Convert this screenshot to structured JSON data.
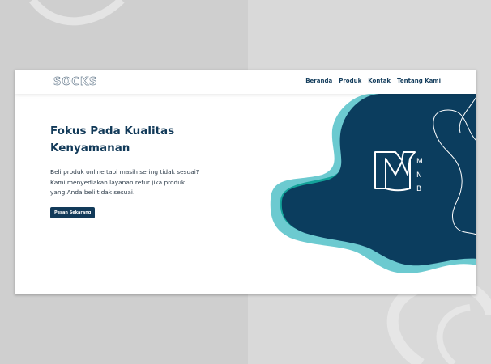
{
  "brand": {
    "logo_text": "SOCKS"
  },
  "nav": {
    "items": [
      {
        "label": "Beranda"
      },
      {
        "label": "Produk"
      },
      {
        "label": "Kontak"
      },
      {
        "label": "Tentang Kami"
      }
    ]
  },
  "hero": {
    "title_lines": [
      "Fokus Pada Kualitas",
      "Kenyamanan"
    ],
    "description_lines": [
      "Beli produk online tapi masih sering tidak sesuai?",
      "Kami menyediakan layanan retur jika produk",
      "yang Anda beli tidak sesuai."
    ],
    "cta_label": "Pesan Sekarang"
  },
  "mark": {
    "letters": [
      "M",
      "N",
      "B"
    ],
    "icon": "mnb-monogram-icon"
  },
  "colors": {
    "navy": "#0b3d5e",
    "teal": "#14a39a",
    "aqua": "#6ccad0",
    "text_dark": "#123a59"
  }
}
